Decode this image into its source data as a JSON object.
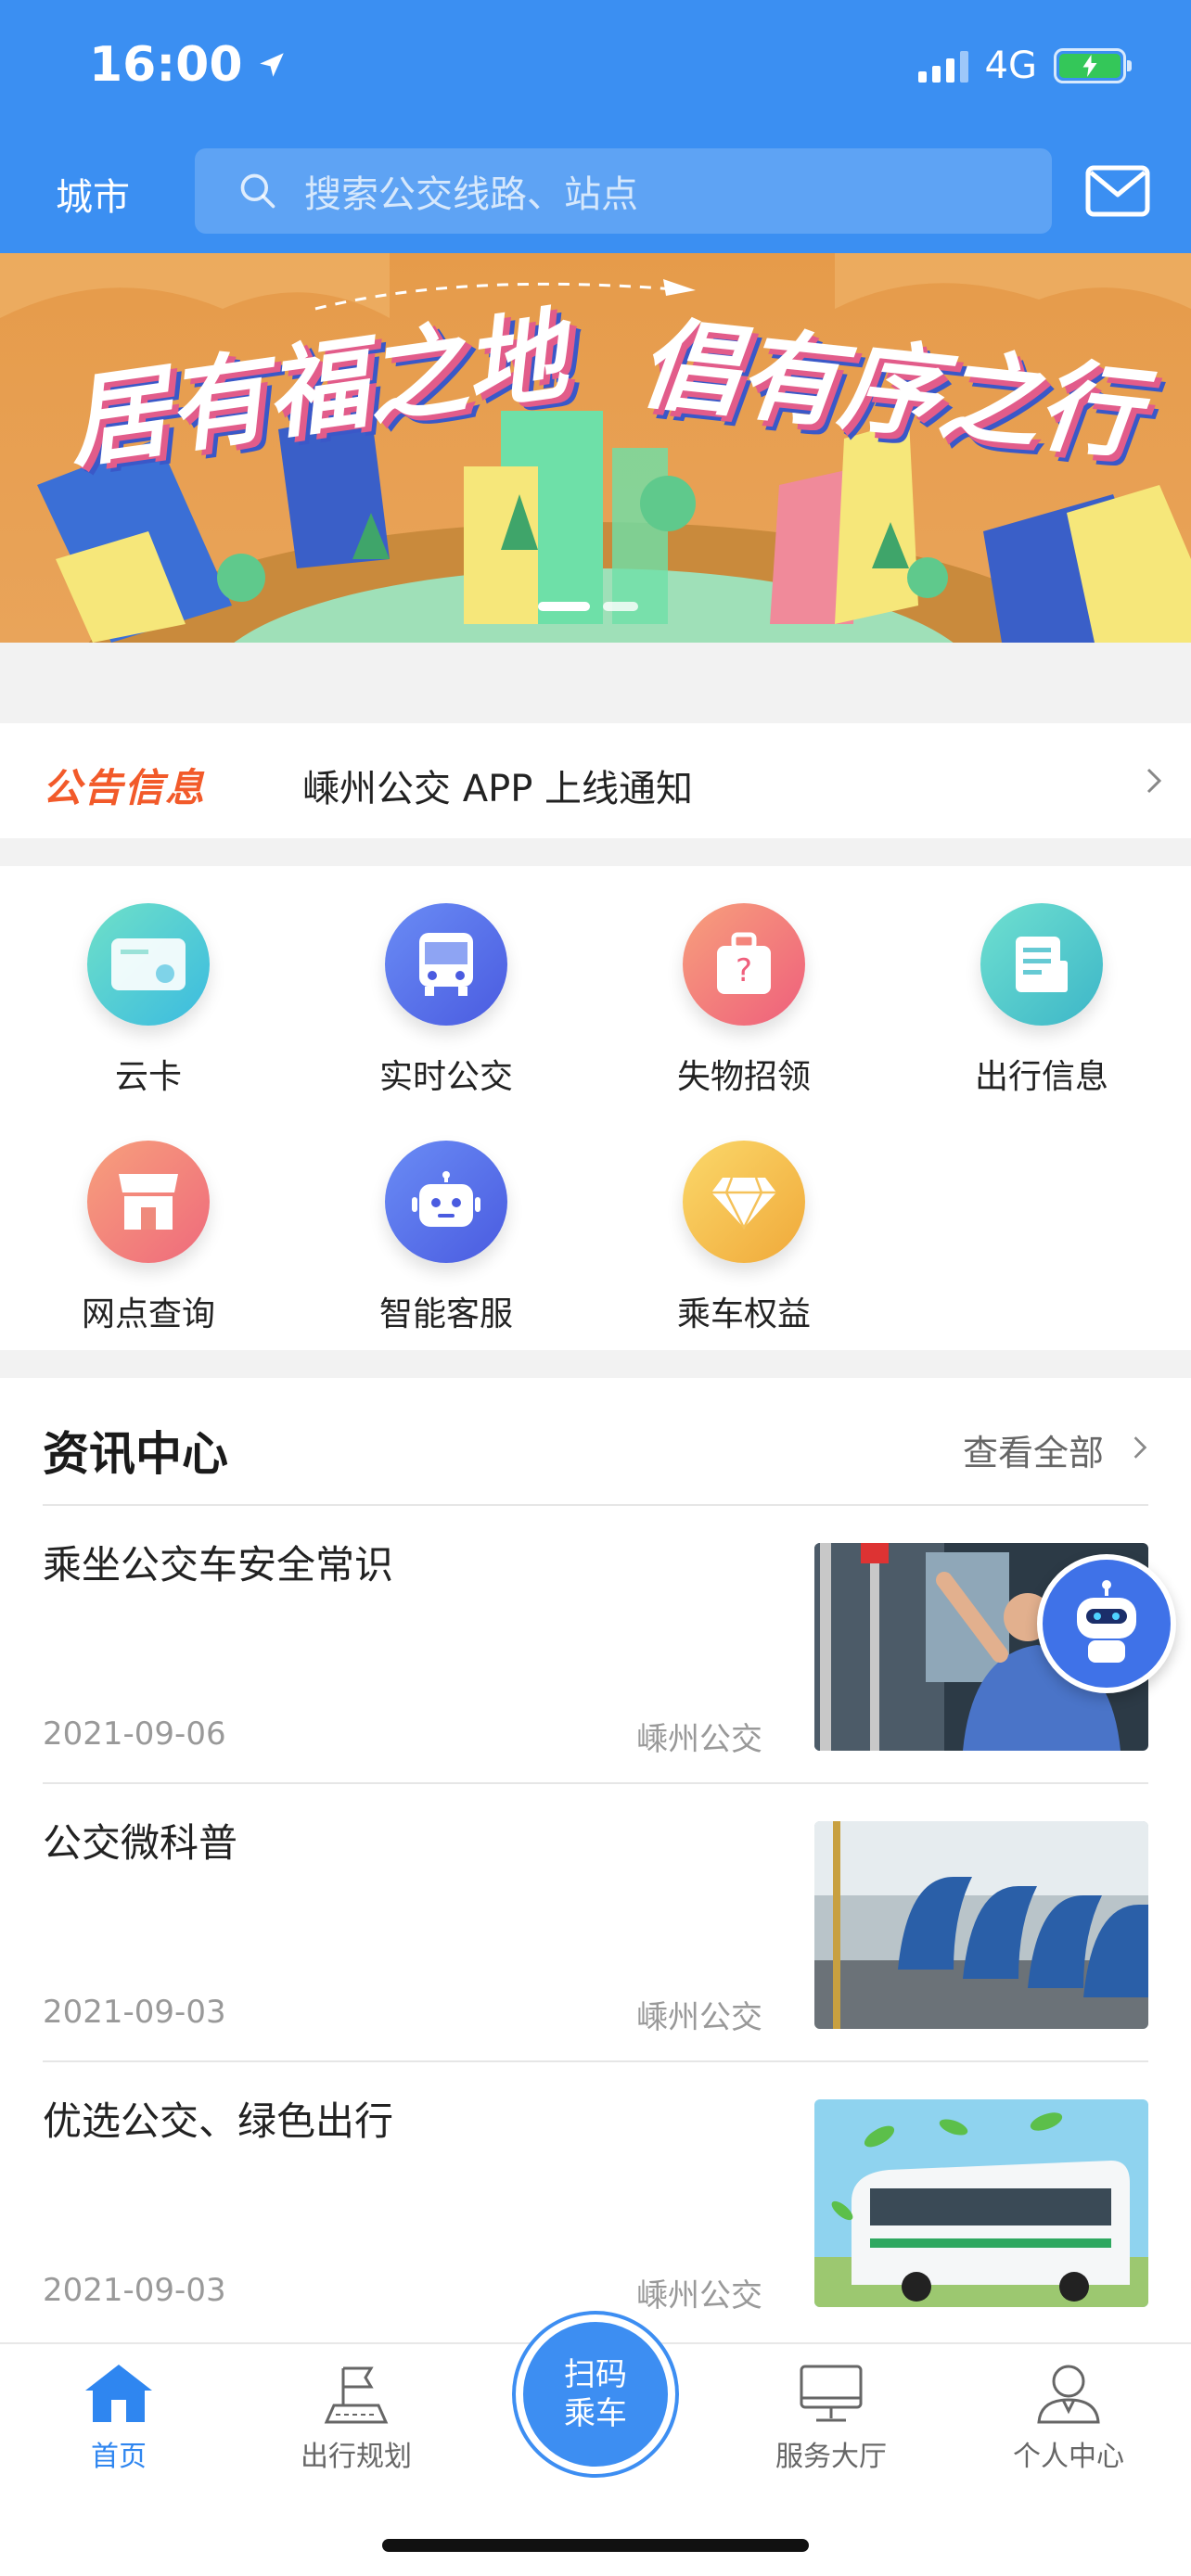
{
  "status": {
    "time": "16:00",
    "network": "4G"
  },
  "header": {
    "city": "城市",
    "search_placeholder": "搜索公交线路、站点"
  },
  "banner": {
    "text_left": "居有福之地",
    "text_right": "倡有序之行"
  },
  "notice": {
    "tag": "公告信息",
    "text": "嵊州公交 APP 上线通知"
  },
  "functions": [
    {
      "label": "云卡",
      "icon": "cloud-card-icon"
    },
    {
      "label": "实时公交",
      "icon": "bus-icon"
    },
    {
      "label": "失物招领",
      "icon": "lost-found-icon"
    },
    {
      "label": "出行信息",
      "icon": "travel-info-icon"
    },
    {
      "label": "网点查询",
      "icon": "store-icon"
    },
    {
      "label": "智能客服",
      "icon": "robot-icon"
    },
    {
      "label": "乘车权益",
      "icon": "diamond-icon"
    }
  ],
  "news": {
    "title": "资讯中心",
    "more": "查看全部",
    "items": [
      {
        "title": "乘坐公交车安全常识",
        "date": "2021-09-06",
        "source": "嵊州公交"
      },
      {
        "title": "公交微科普",
        "date": "2021-09-03",
        "source": "嵊州公交"
      },
      {
        "title": "优选公交、绿色出行",
        "date": "2021-09-03",
        "source": "嵊州公交"
      }
    ]
  },
  "tabbar": {
    "home": "首页",
    "plan": "出行规划",
    "scan_line1": "扫码",
    "scan_line2": "乘车",
    "service": "服务大厅",
    "profile": "个人中心"
  },
  "colors": {
    "brand": "#3b8ff2",
    "notice_tag": "#f25a2a",
    "tab_active": "#2f86f0"
  }
}
